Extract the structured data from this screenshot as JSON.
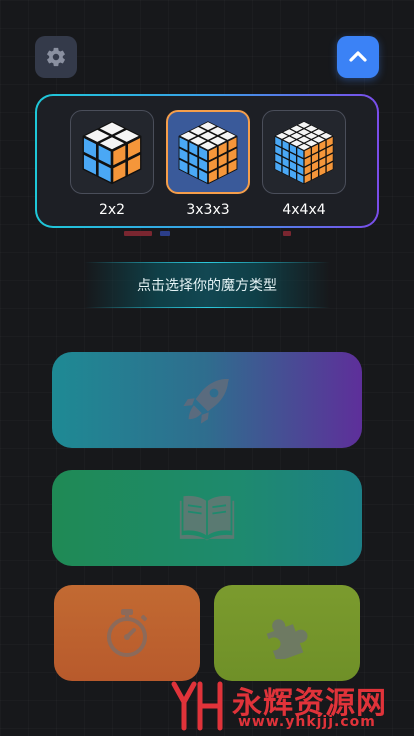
{
  "header": {
    "settings_icon": "gear-icon",
    "collapse_icon": "chevron-up-icon"
  },
  "cube_picker": {
    "options": [
      {
        "label": "2x2",
        "size": 2,
        "selected": false
      },
      {
        "label": "3x3x3",
        "size": 3,
        "selected": true
      },
      {
        "label": "4x4x4",
        "size": 4,
        "selected": false
      }
    ]
  },
  "hint": {
    "text": "点击选择你的魔方类型"
  },
  "menu": {
    "play_icon": "rocket-icon",
    "learn_icon": "book-icon",
    "timer_icon": "stopwatch-icon",
    "puzzle_icon": "puzzle-piece-icon"
  },
  "watermark": {
    "logo_text": "YH",
    "title": "永辉资源网",
    "url": "www.yhkjjj.com"
  },
  "colors": {
    "accent_blue": "#3b82f6",
    "selected_border": "#f59e4b",
    "cube_blue": "#4aa8f5",
    "cube_orange": "#f5963a",
    "cube_white": "#f5f5f5",
    "watermark_red": "#e0333a"
  }
}
